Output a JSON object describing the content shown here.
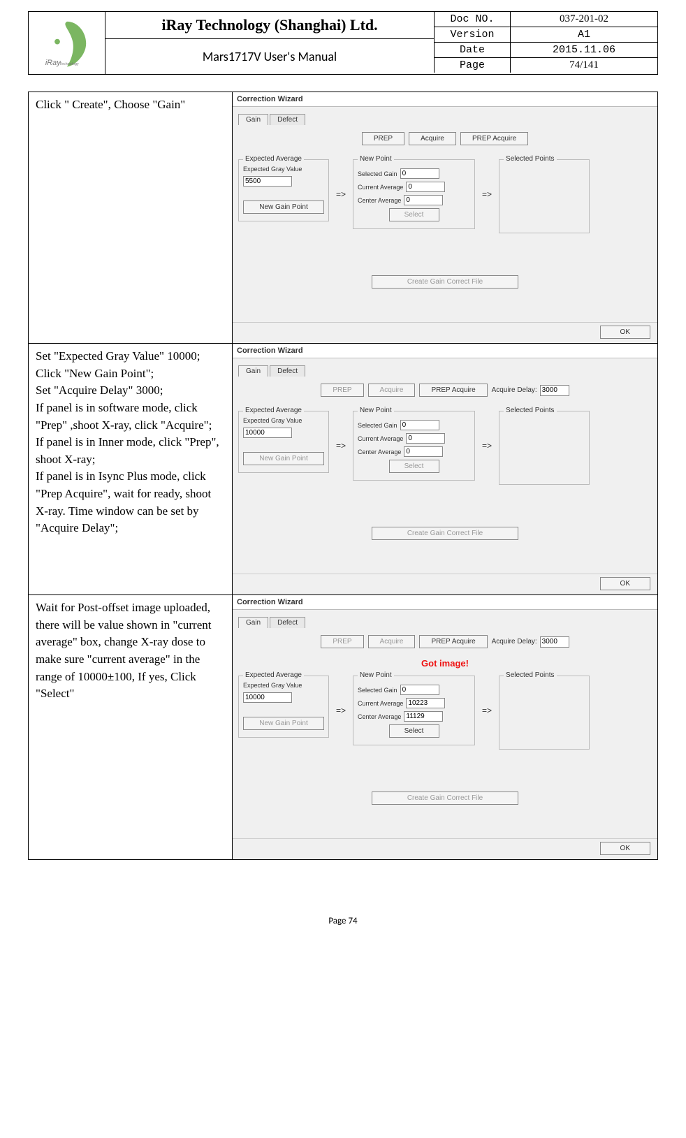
{
  "header": {
    "company": "iRay Technology (Shanghai) Ltd.",
    "manual": "Mars1717V User's Manual",
    "meta": {
      "docno_k": "Doc NO.",
      "docno_v": "037-201-02",
      "ver_k": "Version",
      "ver_v": "A1",
      "date_k": "Date",
      "date_v": "2015.11.06",
      "page_k": "Page",
      "page_v": "74/141"
    }
  },
  "rows": [
    {
      "instr": "Click \" Create\", Choose \"Gain\"",
      "shot": {
        "acq_delay": null,
        "expected": "5500",
        "new_gain_disabled": false,
        "sel_gain": "0",
        "cur_avg": "0",
        "cen_avg": "0",
        "select_disabled": true,
        "prep_dis": false,
        "acq_dis": false,
        "got_image": false,
        "create_dis": true
      }
    },
    {
      "instr": "Set \"Expected Gray Value\" 10000;\nClick \"New Gain Point\";\nSet \"Acquire Delay\" 3000;\nIf panel is in software mode, click \"Prep\" ,shoot X-ray, click \"Acquire\";\nIf panel is in Inner mode, click \"Prep\", shoot X-ray;\nIf panel is in Isync Plus mode, click \"Prep Acquire\", wait for ready, shoot X-ray. Time window can be set by \"Acquire Delay\";",
      "shot": {
        "acq_delay": "3000",
        "expected": "10000",
        "new_gain_disabled": true,
        "sel_gain": "0",
        "cur_avg": "0",
        "cen_avg": "0",
        "select_disabled": true,
        "prep_dis": true,
        "acq_dis": true,
        "got_image": false,
        "create_dis": true
      }
    },
    {
      "instr": "Wait for Post-offset image uploaded, there will be value shown in \"current average\" box, change X-ray dose to make sure \"current average\" in the range of 10000±100, If yes, Click \"Select\"",
      "shot": {
        "acq_delay": "3000",
        "expected": "10000",
        "new_gain_disabled": true,
        "sel_gain": "0",
        "cur_avg": "10223",
        "cen_avg": "11129",
        "select_disabled": false,
        "prep_dis": true,
        "acq_dis": true,
        "got_image": true,
        "create_dis": true
      }
    }
  ],
  "labels": {
    "wizard_title": "Correction Wizard",
    "tab_gain": "Gain",
    "tab_defect": "Defect",
    "btn_prep": "PREP",
    "btn_acq": "Acquire",
    "btn_prepacq": "PREP Acquire",
    "acq_delay": "Acquire Delay:",
    "fs_exp": "Expected Average",
    "lbl_exp": "Expected Gray Value",
    "btn_newgain": "New Gain Point",
    "fs_np": "New Point",
    "lbl_selgain": "Selected Gain",
    "lbl_curavg": "Current Average",
    "lbl_cenavg": "Center Average",
    "btn_select": "Select",
    "fs_sp": "Selected Points",
    "arrow": "=>",
    "btn_create": "Create Gain Correct File",
    "btn_ok": "OK",
    "got_image": "Got image!"
  },
  "footer": "Page 74"
}
